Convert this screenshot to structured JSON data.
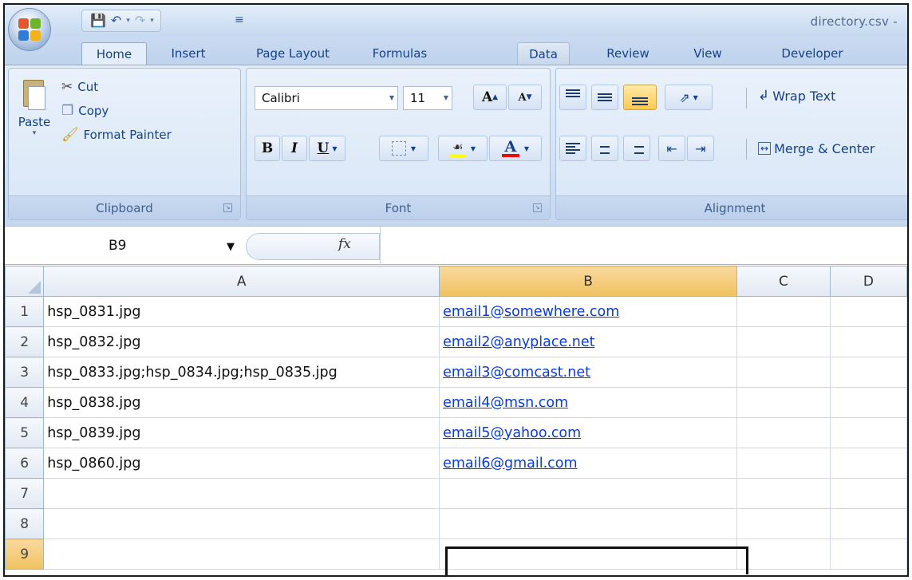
{
  "app": {
    "doc_title": "directory.csv -"
  },
  "qat": {
    "save_icon": "save-icon",
    "undo_icon": "undo-icon",
    "redo_icon": "redo-icon",
    "customize_icon": "customize-icon"
  },
  "tabs": [
    "Home",
    "Insert",
    "Page Layout",
    "Formulas",
    "Data",
    "Review",
    "View",
    "Developer"
  ],
  "active_tab": "Home",
  "clipboard": {
    "paste_label": "Paste",
    "cut_label": "Cut",
    "copy_label": "Copy",
    "format_painter_label": "Format Painter",
    "group_label": "Clipboard"
  },
  "font": {
    "font_name": "Calibri",
    "font_size": "11",
    "group_label": "Font",
    "bold": "B",
    "italic": "I",
    "underline": "U",
    "grow": "A",
    "shrink": "A",
    "font_color_letter": "A",
    "fill_color": "#ffff00",
    "font_color": "#ff0000"
  },
  "alignment": {
    "wrap_text_label": "Wrap Text",
    "merge_label": "Merge & Center",
    "group_label": "Alignment"
  },
  "formula_bar": {
    "name_box": "B9",
    "fx_label": "fx",
    "formula": ""
  },
  "sheet": {
    "columns": [
      "A",
      "B",
      "C",
      "D"
    ],
    "selected_column": "B",
    "selected_row": "9",
    "rows": [
      {
        "num": "1",
        "a": "hsp_0831.jpg",
        "b": "email1@somewhere.com"
      },
      {
        "num": "2",
        "a": "hsp_0832.jpg",
        "b": "email2@anyplace.net"
      },
      {
        "num": "3",
        "a": "hsp_0833.jpg;hsp_0834.jpg;hsp_0835.jpg",
        "b": "email3@comcast.net"
      },
      {
        "num": "4",
        "a": "hsp_0838.jpg",
        "b": "email4@msn.com"
      },
      {
        "num": "5",
        "a": "hsp_0839.jpg",
        "b": "email5@yahoo.com"
      },
      {
        "num": "6",
        "a": "hsp_0860.jpg",
        "b": "email6@gmail.com"
      },
      {
        "num": "7",
        "a": "",
        "b": ""
      },
      {
        "num": "8",
        "a": "",
        "b": ""
      },
      {
        "num": "9",
        "a": "",
        "b": ""
      }
    ],
    "link_color": "#0a3cd6",
    "selection_header_color": "#f4c86a"
  }
}
